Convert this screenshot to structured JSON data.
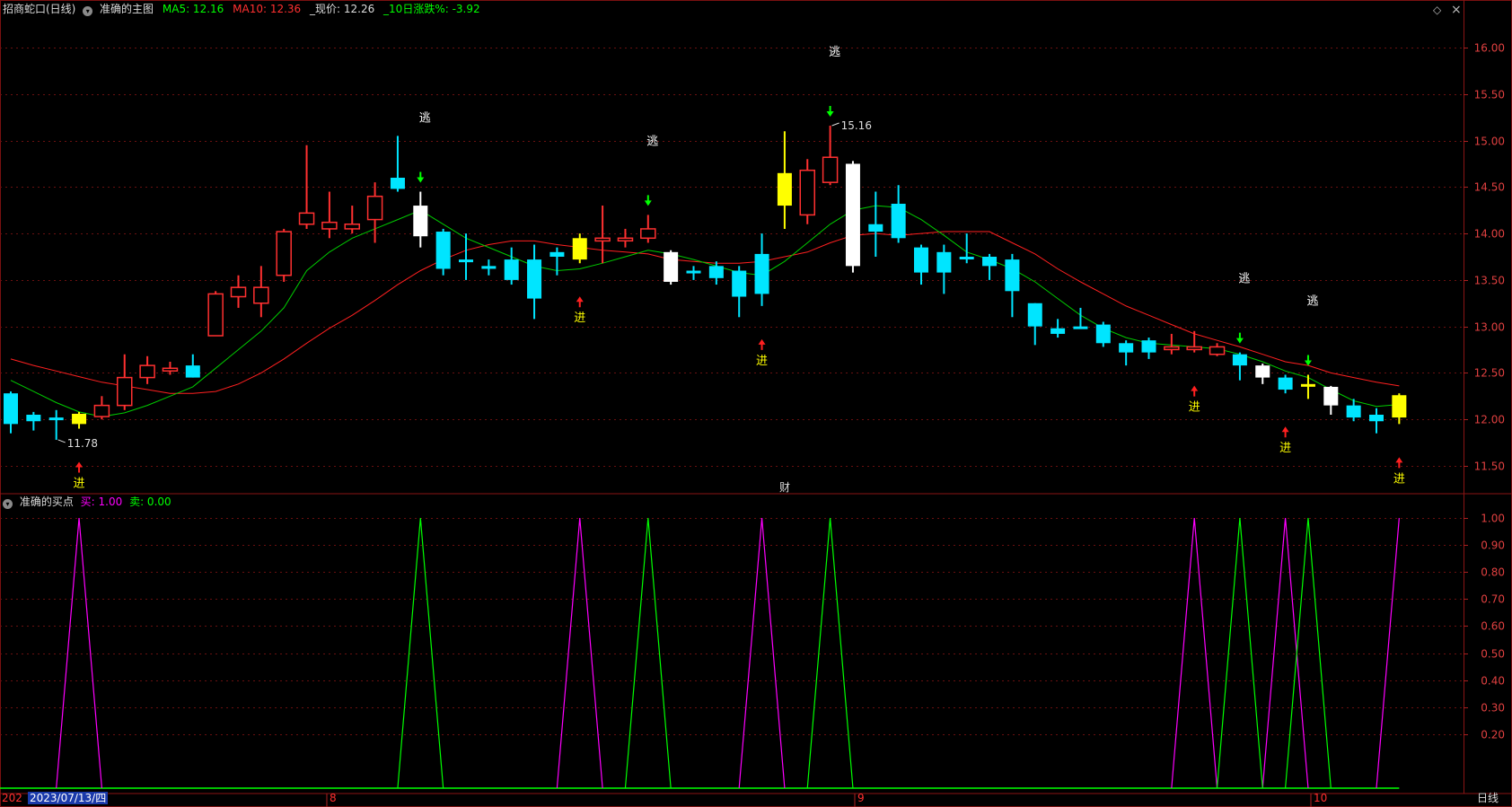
{
  "header": {
    "stock": "招商蛇口(日线)",
    "indicator": "准确的主图",
    "ma5_label": "MA5: 12.16",
    "ma10_label": "MA10: 12.36",
    "price_label": "_现价: 12.26",
    "change_label": "_10日涨跌%: -3.92",
    "diamond": "◇",
    "close": "×"
  },
  "subheader": {
    "indicator": "准确的买点",
    "buy_label": "买: 1.00",
    "sell_label": "卖: 0.00"
  },
  "colors": {
    "up": "#ff3030",
    "down": "#00e5ff",
    "ma5": "#00cc00",
    "ma10": "#ff2020",
    "buy": "#ff00ff",
    "sell": "#00ff00",
    "grid": "#7a1010",
    "yellow": "#ffff00"
  },
  "price_axis": [
    "16.00",
    "15.50",
    "15.00",
    "14.50",
    "14.00",
    "13.50",
    "13.00",
    "12.50",
    "12.00",
    "11.50"
  ],
  "osc_axis": [
    "1.00",
    "0.90",
    "0.80",
    "0.70",
    "0.60",
    "0.50",
    "0.40",
    "0.30",
    "0.20"
  ],
  "x_axis": {
    "start": "202",
    "cursor_date": "2023/07/13/四",
    "m8": "8",
    "m9": "9",
    "m10": "10",
    "period": "日线"
  },
  "annotations": {
    "low_label": "11.78",
    "high_label": "15.16",
    "cai": "财",
    "buy_text": "进",
    "sell_text": "逃"
  },
  "chart_data": {
    "type": "candlestick",
    "candles": [
      {
        "o": 12.28,
        "h": 12.3,
        "l": 11.85,
        "c": 11.95,
        "k": "d"
      },
      {
        "o": 12.05,
        "h": 12.08,
        "l": 11.88,
        "c": 11.98,
        "k": "d"
      },
      {
        "o": 12.02,
        "h": 12.1,
        "l": 11.78,
        "c": 12.0,
        "k": "d"
      },
      {
        "o": 11.95,
        "h": 12.08,
        "l": 11.9,
        "c": 12.06,
        "k": "y"
      },
      {
        "o": 12.03,
        "h": 12.25,
        "l": 12.0,
        "c": 12.15,
        "k": "u"
      },
      {
        "o": 12.15,
        "h": 12.7,
        "l": 12.1,
        "c": 12.45,
        "k": "u"
      },
      {
        "o": 12.45,
        "h": 12.68,
        "l": 12.38,
        "c": 12.58,
        "k": "u"
      },
      {
        "o": 12.55,
        "h": 12.62,
        "l": 12.48,
        "c": 12.55,
        "k": "u"
      },
      {
        "o": 12.58,
        "h": 12.7,
        "l": 12.45,
        "c": 12.45,
        "k": "d"
      },
      {
        "o": 12.9,
        "h": 13.38,
        "l": 12.9,
        "c": 13.35,
        "k": "u"
      },
      {
        "o": 13.32,
        "h": 13.55,
        "l": 13.2,
        "c": 13.42,
        "k": "u"
      },
      {
        "o": 13.25,
        "h": 13.65,
        "l": 13.1,
        "c": 13.42,
        "k": "u"
      },
      {
        "o": 13.55,
        "h": 14.05,
        "l": 13.48,
        "c": 14.02,
        "k": "u"
      },
      {
        "o": 14.1,
        "h": 14.95,
        "l": 14.05,
        "c": 14.22,
        "k": "u"
      },
      {
        "o": 14.05,
        "h": 14.45,
        "l": 13.95,
        "c": 14.12,
        "k": "u"
      },
      {
        "o": 14.05,
        "h": 14.3,
        "l": 14.0,
        "c": 14.1,
        "k": "u"
      },
      {
        "o": 14.15,
        "h": 14.55,
        "l": 13.9,
        "c": 14.4,
        "k": "u"
      },
      {
        "o": 14.6,
        "h": 15.05,
        "l": 14.45,
        "c": 14.48,
        "k": "d"
      },
      {
        "o": 14.3,
        "h": 14.45,
        "l": 13.85,
        "c": 13.97,
        "k": "w"
      },
      {
        "o": 14.02,
        "h": 14.05,
        "l": 13.55,
        "c": 13.62,
        "k": "d"
      },
      {
        "o": 13.72,
        "h": 14.0,
        "l": 13.5,
        "c": 13.72,
        "k": "d"
      },
      {
        "o": 13.65,
        "h": 13.72,
        "l": 13.55,
        "c": 13.62,
        "k": "d"
      },
      {
        "o": 13.72,
        "h": 13.85,
        "l": 13.45,
        "c": 13.5,
        "k": "d"
      },
      {
        "o": 13.72,
        "h": 13.88,
        "l": 13.08,
        "c": 13.3,
        "k": "d"
      },
      {
        "o": 13.8,
        "h": 13.85,
        "l": 13.55,
        "c": 13.75,
        "k": "d"
      },
      {
        "o": 13.72,
        "h": 14.0,
        "l": 13.68,
        "c": 13.95,
        "k": "y"
      },
      {
        "o": 13.92,
        "h": 14.3,
        "l": 13.68,
        "c": 13.95,
        "k": "u"
      },
      {
        "o": 13.95,
        "h": 14.05,
        "l": 13.85,
        "c": 13.95,
        "k": "u"
      },
      {
        "o": 13.95,
        "h": 14.2,
        "l": 13.9,
        "c": 14.05,
        "k": "u"
      },
      {
        "o": 13.8,
        "h": 13.82,
        "l": 13.45,
        "c": 13.48,
        "k": "w"
      },
      {
        "o": 13.6,
        "h": 13.65,
        "l": 13.5,
        "c": 13.58,
        "k": "d"
      },
      {
        "o": 13.65,
        "h": 13.7,
        "l": 13.45,
        "c": 13.52,
        "k": "d"
      },
      {
        "o": 13.6,
        "h": 13.65,
        "l": 13.1,
        "c": 13.32,
        "k": "d"
      },
      {
        "o": 13.78,
        "h": 14.0,
        "l": 13.22,
        "c": 13.35,
        "k": "d"
      },
      {
        "o": 14.3,
        "h": 15.1,
        "l": 14.05,
        "c": 14.65,
        "k": "y"
      },
      {
        "o": 14.2,
        "h": 14.8,
        "l": 14.1,
        "c": 14.68,
        "k": "u"
      },
      {
        "o": 14.55,
        "h": 15.16,
        "l": 14.52,
        "c": 14.82,
        "k": "u"
      },
      {
        "o": 14.75,
        "h": 14.78,
        "l": 13.58,
        "c": 13.65,
        "k": "w"
      },
      {
        "o": 14.1,
        "h": 14.45,
        "l": 13.75,
        "c": 14.02,
        "k": "d"
      },
      {
        "o": 14.32,
        "h": 14.52,
        "l": 13.9,
        "c": 13.95,
        "k": "d"
      },
      {
        "o": 13.85,
        "h": 13.88,
        "l": 13.45,
        "c": 13.58,
        "k": "d"
      },
      {
        "o": 13.8,
        "h": 13.88,
        "l": 13.35,
        "c": 13.58,
        "k": "d"
      },
      {
        "o": 13.75,
        "h": 14.0,
        "l": 13.68,
        "c": 13.75,
        "k": "d"
      },
      {
        "o": 13.75,
        "h": 13.78,
        "l": 13.5,
        "c": 13.65,
        "k": "d"
      },
      {
        "o": 13.72,
        "h": 13.78,
        "l": 13.1,
        "c": 13.38,
        "k": "d"
      },
      {
        "o": 13.25,
        "h": 13.25,
        "l": 12.8,
        "c": 13.0,
        "k": "d"
      },
      {
        "o": 12.98,
        "h": 13.08,
        "l": 12.88,
        "c": 12.92,
        "k": "d"
      },
      {
        "o": 13.0,
        "h": 13.2,
        "l": 12.98,
        "c": 12.98,
        "k": "d"
      },
      {
        "o": 13.02,
        "h": 13.05,
        "l": 12.78,
        "c": 12.82,
        "k": "d"
      },
      {
        "o": 12.82,
        "h": 12.85,
        "l": 12.58,
        "c": 12.72,
        "k": "d"
      },
      {
        "o": 12.85,
        "h": 12.88,
        "l": 12.65,
        "c": 12.72,
        "k": "d"
      },
      {
        "o": 12.78,
        "h": 12.92,
        "l": 12.7,
        "c": 12.78,
        "k": "u"
      },
      {
        "o": 12.78,
        "h": 12.95,
        "l": 12.72,
        "c": 12.78,
        "k": "u"
      },
      {
        "o": 12.7,
        "h": 12.82,
        "l": 12.68,
        "c": 12.78,
        "k": "u"
      },
      {
        "o": 12.7,
        "h": 12.72,
        "l": 12.42,
        "c": 12.58,
        "k": "d"
      },
      {
        "o": 12.58,
        "h": 12.6,
        "l": 12.38,
        "c": 12.45,
        "k": "w"
      },
      {
        "o": 12.45,
        "h": 12.48,
        "l": 12.28,
        "c": 12.32,
        "k": "d"
      },
      {
        "o": 12.38,
        "h": 12.48,
        "l": 12.22,
        "c": 12.38,
        "k": "y"
      },
      {
        "o": 12.35,
        "h": 12.36,
        "l": 12.05,
        "c": 12.15,
        "k": "w"
      },
      {
        "o": 12.15,
        "h": 12.22,
        "l": 11.98,
        "c": 12.02,
        "k": "d"
      },
      {
        "o": 12.05,
        "h": 12.12,
        "l": 11.85,
        "c": 11.98,
        "k": "d"
      },
      {
        "o": 12.02,
        "h": 12.28,
        "l": 11.95,
        "c": 12.26,
        "k": "y"
      }
    ],
    "ma5": [
      12.42,
      12.3,
      12.18,
      12.08,
      12.03,
      12.07,
      12.15,
      12.25,
      12.35,
      12.55,
      12.75,
      12.95,
      13.2,
      13.6,
      13.8,
      13.95,
      14.05,
      14.15,
      14.25,
      14.1,
      13.95,
      13.85,
      13.75,
      13.65,
      13.6,
      13.62,
      13.68,
      13.75,
      13.82,
      13.78,
      13.72,
      13.65,
      13.58,
      13.55,
      13.7,
      13.9,
      14.1,
      14.25,
      14.3,
      14.28,
      14.15,
      13.98,
      13.8,
      13.72,
      13.62,
      13.48,
      13.3,
      13.12,
      12.98,
      12.88,
      12.82,
      12.8,
      12.78,
      12.76,
      12.7,
      12.62,
      12.52,
      12.45,
      12.32,
      12.2,
      12.14,
      12.16
    ],
    "ma10": [
      12.65,
      12.58,
      12.52,
      12.46,
      12.4,
      12.36,
      12.32,
      12.28,
      12.28,
      12.3,
      12.38,
      12.5,
      12.65,
      12.82,
      12.98,
      13.12,
      13.28,
      13.45,
      13.6,
      13.72,
      13.82,
      13.88,
      13.92,
      13.92,
      13.88,
      13.85,
      13.82,
      13.8,
      13.78,
      13.72,
      13.7,
      13.68,
      13.68,
      13.7,
      13.75,
      13.8,
      13.9,
      13.98,
      14.0,
      13.98,
      14.0,
      14.02,
      14.02,
      14.02,
      13.9,
      13.78,
      13.62,
      13.48,
      13.35,
      13.22,
      13.12,
      13.02,
      12.92,
      12.85,
      12.78,
      12.7,
      12.62,
      12.58,
      12.5,
      12.45,
      12.4,
      12.36
    ],
    "buy_signals": [
      3,
      25,
      33,
      52,
      56,
      61
    ],
    "sell_signals": [
      18,
      28,
      36,
      54,
      57
    ],
    "osc_range": [
      0,
      1.05
    ]
  }
}
